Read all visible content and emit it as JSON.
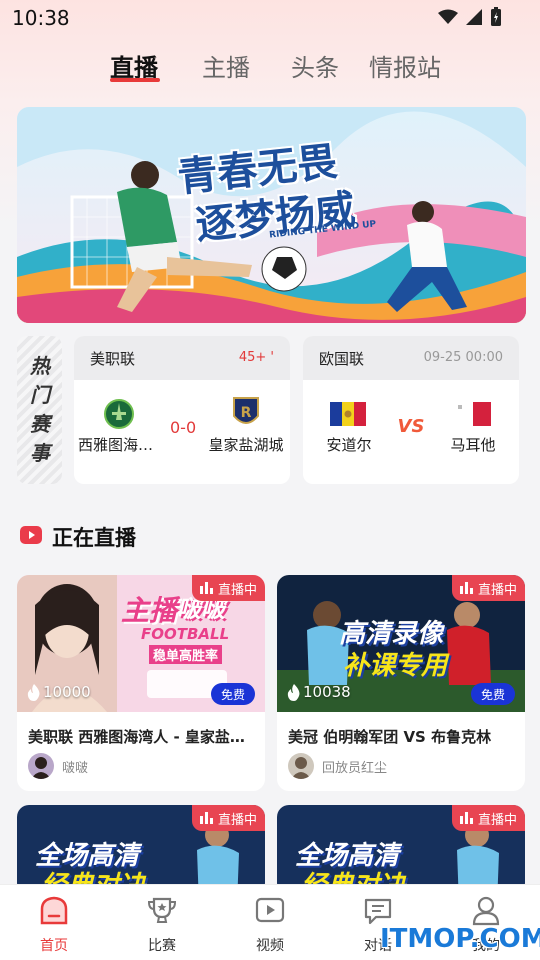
{
  "status": {
    "time": "10:38"
  },
  "tabs": [
    {
      "label": "直播",
      "active": true
    },
    {
      "label": "主播",
      "active": false
    },
    {
      "label": "头条",
      "active": false
    },
    {
      "label": "情报站",
      "active": false
    }
  ],
  "banner": {
    "line1": "青春无畏",
    "line2": "逐梦扬威",
    "sub": "RIDING THE WIND UP"
  },
  "hot_matches": {
    "label": "热门赛事",
    "matches": [
      {
        "league": "美职联",
        "status": "45+ '",
        "home": "西雅图海湾人",
        "away": "皇家盐湖城",
        "score": "0-0"
      },
      {
        "league": "欧国联",
        "time": "09-25 00:00",
        "home": "安道尔",
        "away": "马耳他",
        "vs": "VS"
      }
    ]
  },
  "live_section": {
    "title": "正在直播",
    "badge": "直播中",
    "free": "免费",
    "streams": [
      {
        "title": "美职联 西雅图海湾人 - 皇家盐湖城",
        "views": "10000",
        "anchor": "啵啵",
        "thumb_text1": "主播",
        "thumb_text2": "啵啵",
        "thumb_text3": "FOOTBALL",
        "thumb_text4": "稳单高胜率"
      },
      {
        "title": "美冠 伯明翰军团 VS 布鲁克林",
        "views": "10038",
        "anchor": "回放员红尘",
        "thumb_text1": "高清录像",
        "thumb_text2": "补课专用"
      },
      {
        "thumb_text1": "全场高清",
        "thumb_text2": "经典对决"
      },
      {
        "thumb_text1": "全场高清",
        "thumb_text2": "经典对决"
      }
    ]
  },
  "bottom_nav": [
    {
      "label": "首页",
      "icon": "home-icon",
      "active": true
    },
    {
      "label": "比赛",
      "icon": "trophy-icon",
      "active": false
    },
    {
      "label": "视频",
      "icon": "video-icon",
      "active": false
    },
    {
      "label": "对话",
      "icon": "chat-icon",
      "active": false
    },
    {
      "label": "我的",
      "icon": "profile-icon",
      "active": false
    }
  ],
  "watermark": "ITMOP.COM",
  "colors": {
    "accent": "#e83a3a",
    "free_badge": "#1a34d6",
    "live_badge": "#e84552"
  }
}
